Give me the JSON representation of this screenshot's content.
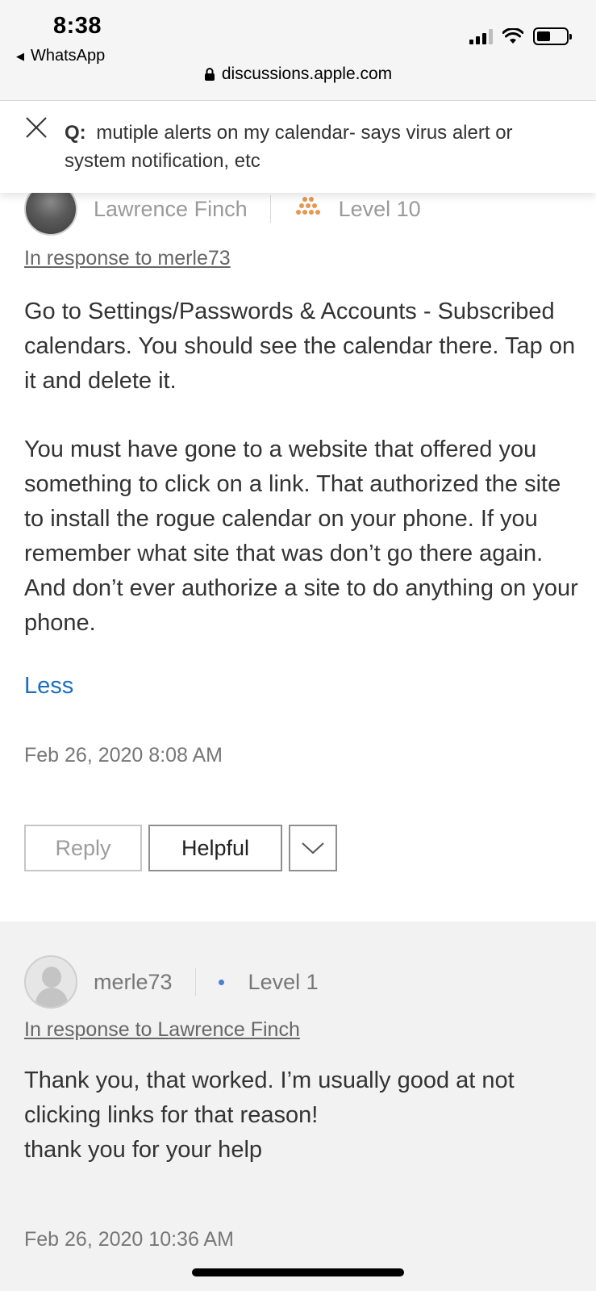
{
  "status_bar": {
    "time": "8:38",
    "back_app": "WhatsApp",
    "url": "discussions.apple.com"
  },
  "question": {
    "label": "Q:",
    "title": "mutiple alerts on my calendar- says virus alert or system notification, etc"
  },
  "post1": {
    "author": "Lawrence Finch",
    "level": "Level 10",
    "in_response": "In response to merle73",
    "paragraph1": "Go to Settings/Passwords & Accounts - Subscribed calendars. You should see the calendar there. Tap on it and delete it.",
    "paragraph2": "You must have gone to a website that offered you something to click on a link. That authorized the site to install the rogue calendar on your phone. If you remember what site that was don’t go there again. And don’t ever authorize a site to do anything on your phone.",
    "less": "Less",
    "date": "Feb 26, 2020 8:08 AM",
    "reply_label": "Reply",
    "helpful_label": "Helpful"
  },
  "post2": {
    "author": "merle73",
    "level": "Level 1",
    "in_response": "In response to Lawrence Finch",
    "line1": "Thank you, that worked. I’m usually good at not clicking links for that reason!",
    "line2": "thank you for your help",
    "date": "Feb 26, 2020 10:36 AM"
  },
  "colors": {
    "link_blue": "#1a6fbf",
    "level10_icon": "#e8974f",
    "level1_dot": "#4b7fd6"
  }
}
